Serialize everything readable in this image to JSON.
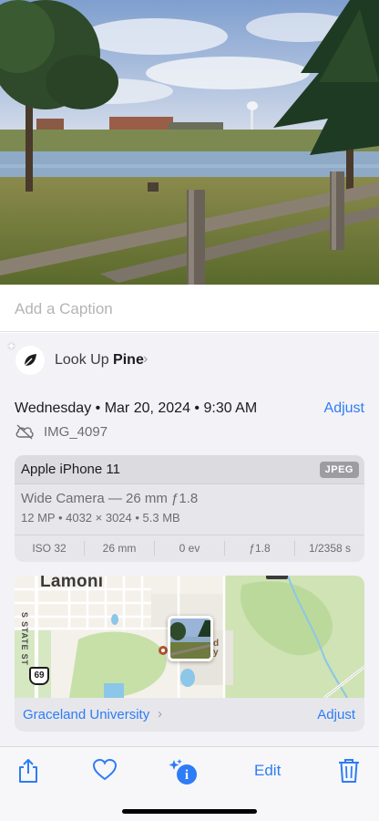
{
  "photo": {
    "icon": "landscape-photo"
  },
  "caption": {
    "placeholder": "Add a Caption",
    "value": ""
  },
  "lookup": {
    "prefix": "Look Up",
    "subject": "Pine",
    "chevron": "›",
    "icon": "leaf-icon"
  },
  "info": {
    "date": "Wednesday • Mar 20, 2024 • 9:30 AM",
    "adjust_label": "Adjust",
    "filename": "IMG_4097",
    "cloud_icon": "cloud-slash-icon"
  },
  "device": {
    "name": "Apple iPhone 11",
    "format": "JPEG",
    "lens": "Wide Camera — 26 mm ƒ1.8",
    "specs": "12 MP  •  4032 × 3024  •  5.3 MB",
    "exif": [
      "ISO 32",
      "26 mm",
      "0 ev",
      "ƒ1.8",
      "1/2358 s"
    ]
  },
  "map": {
    "town": "Lamoni",
    "street": "S STATE ST",
    "highway": "69",
    "poi_line1": "d",
    "poi_line2": "y",
    "location_label": "Graceland University",
    "location_chevron": "›",
    "adjust_label": "Adjust"
  },
  "toolbar": {
    "share": "share-icon",
    "favorite": "heart-icon",
    "info": "info-sparkle-icon",
    "edit_label": "Edit",
    "delete": "trash-icon"
  },
  "colors": {
    "accent": "#2e7cf6",
    "panel": "#f2f2f7",
    "card": "#e7e7eb"
  }
}
